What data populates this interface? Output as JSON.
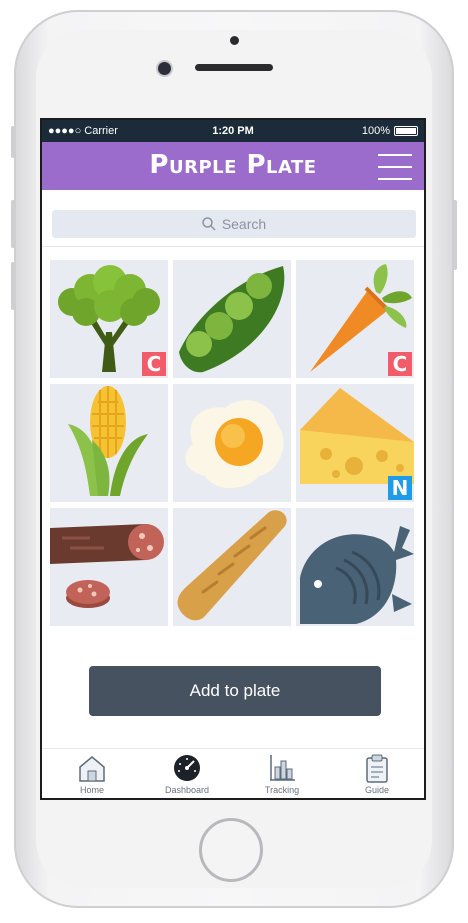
{
  "status": {
    "carrier": "●●●●○ Carrier",
    "time": "1:20 PM",
    "battery": "100%"
  },
  "header": {
    "title": "Purple Plate"
  },
  "search": {
    "placeholder": "Search"
  },
  "foods": [
    {
      "name": "broccoli",
      "badge": "C",
      "badge_color": "#f25c6a"
    },
    {
      "name": "peas",
      "badge": "",
      "badge_color": ""
    },
    {
      "name": "carrot",
      "badge": "C",
      "badge_color": "#f25c6a"
    },
    {
      "name": "corn",
      "badge": "",
      "badge_color": ""
    },
    {
      "name": "fried-egg",
      "badge": "",
      "badge_color": ""
    },
    {
      "name": "cheese",
      "badge": "N",
      "badge_color": "#1e9be9"
    },
    {
      "name": "salami",
      "badge": "",
      "badge_color": ""
    },
    {
      "name": "bread",
      "badge": "",
      "badge_color": ""
    },
    {
      "name": "fish",
      "badge": "",
      "badge_color": ""
    }
  ],
  "actions": {
    "add_label": "Add to plate"
  },
  "tabs": [
    {
      "label": "Home",
      "icon": "home-icon"
    },
    {
      "label": "Dashboard",
      "icon": "dashboard-icon"
    },
    {
      "label": "Tracking",
      "icon": "chart-icon"
    },
    {
      "label": "Guide",
      "icon": "clipboard-icon"
    }
  ],
  "colors": {
    "header": "#9b6ccc",
    "button": "#465260",
    "statusbar": "#1c2b39"
  }
}
